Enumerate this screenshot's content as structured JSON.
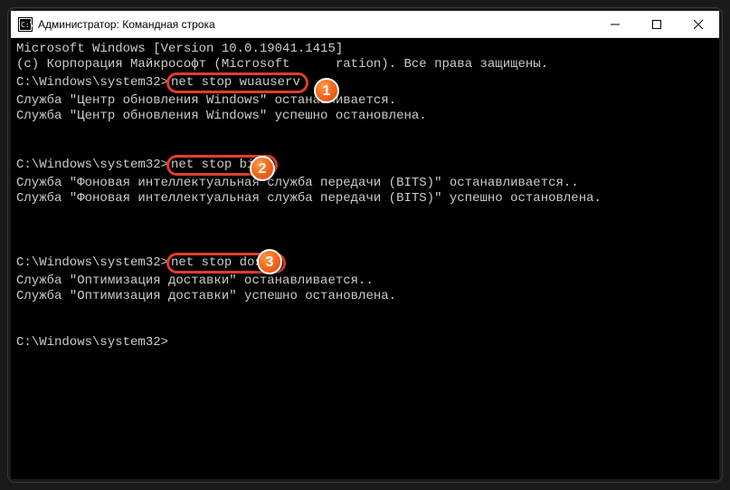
{
  "window": {
    "title": "Администратор: Командная строка"
  },
  "terminal": {
    "line1": "Microsoft Windows [Version 10.0.19041.1415]",
    "line2_a": "(c) Корпорация Майкрософт (Microsoft ",
    "line2_b": "ration). Все права защищены.",
    "blank": "",
    "prompt": "C:\\Windows\\system32>",
    "cmd1": "net stop wuauserv",
    "res1a": "Служба \"Центр обновления Windows\" останавливается.",
    "res1b": "Служба \"Центр обновления Windows\" успешно остановлена.",
    "cmd2": "net stop bits",
    "res2a": "Служба \"Фоновая интеллектуальная служба передачи (BITS)\" останавливается..",
    "res2b": "Служба \"Фоновая интеллектуальная служба передачи (BITS)\" успешно остановлена.",
    "cmd3": "net stop dosvc",
    "res3a": "Служба \"Оптимизация доставки\" останавливается..",
    "res3b": "Служба \"Оптимизация доставки\" успешно остановлена."
  },
  "badges": {
    "b1": "1",
    "b2": "2",
    "b3": "3"
  }
}
